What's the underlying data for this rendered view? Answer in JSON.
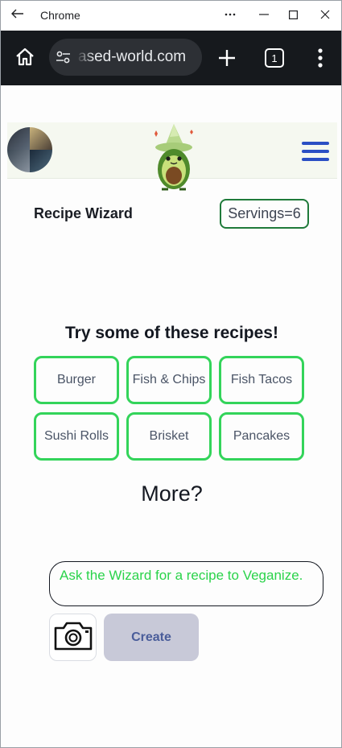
{
  "window": {
    "title": "Chrome"
  },
  "browser": {
    "url_visible": "ased-world.com",
    "tab_count": "1"
  },
  "app": {
    "heading": "Recipe Wizard",
    "servings_label": "Servings=6",
    "try_heading": "Try some of these recipes!",
    "recipes": [
      {
        "label": "Burger"
      },
      {
        "label": "Fish & Chips"
      },
      {
        "label": "Fish Tacos"
      },
      {
        "label": "Sushi Rolls"
      },
      {
        "label": "Brisket"
      },
      {
        "label": "Pancakes"
      }
    ],
    "more_label": "More?",
    "prompt_placeholder": "Ask the Wizard for a recipe to Veganize.",
    "create_label": "Create"
  },
  "colors": {
    "recipe_border": "#33d45a",
    "servings_border": "#1f7a3a",
    "prompt_text": "#2ad34a",
    "create_bg": "#c8c9d8",
    "menu_icon": "#2b4fc4"
  },
  "icons": {
    "back": "arrow-left-icon",
    "minimize": "minimize-icon",
    "maximize": "maximize-icon",
    "close": "close-icon",
    "home": "home-icon",
    "site_info": "tune-icon",
    "new_tab": "plus-icon",
    "tabs": "tab-counter-icon",
    "menu": "vertical-dots-icon",
    "hamburger": "hamburger-menu-icon",
    "camera": "camera-icon"
  }
}
